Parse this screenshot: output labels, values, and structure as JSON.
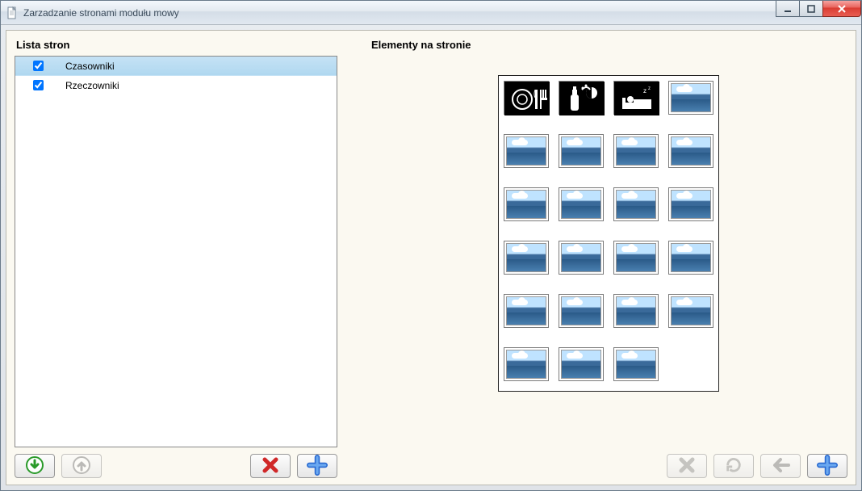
{
  "window": {
    "title": "Zarzadzanie stronami modułu mowy"
  },
  "left": {
    "header": "Lista stron",
    "items": [
      {
        "label": "Czasowniki",
        "checked": true,
        "selected": true
      },
      {
        "label": "Rzeczowniki",
        "checked": true,
        "selected": false
      }
    ]
  },
  "right": {
    "header": "Elementy na stronie",
    "tiles": [
      {
        "kind": "icon",
        "name": "eat-icon"
      },
      {
        "kind": "icon",
        "name": "drink-icon"
      },
      {
        "kind": "icon",
        "name": "sleep-icon"
      },
      {
        "kind": "placeholder"
      },
      {
        "kind": "placeholder"
      },
      {
        "kind": "placeholder"
      },
      {
        "kind": "placeholder"
      },
      {
        "kind": "placeholder"
      },
      {
        "kind": "placeholder"
      },
      {
        "kind": "placeholder"
      },
      {
        "kind": "placeholder"
      },
      {
        "kind": "placeholder"
      },
      {
        "kind": "placeholder"
      },
      {
        "kind": "placeholder"
      },
      {
        "kind": "placeholder"
      },
      {
        "kind": "placeholder"
      },
      {
        "kind": "placeholder"
      },
      {
        "kind": "placeholder"
      },
      {
        "kind": "placeholder"
      },
      {
        "kind": "placeholder"
      },
      {
        "kind": "placeholder"
      },
      {
        "kind": "placeholder"
      },
      {
        "kind": "placeholder"
      }
    ]
  },
  "buttons": {
    "left": [
      {
        "name": "move-down-button",
        "icon": "arrow-down-circle-icon",
        "enabled": true
      },
      {
        "name": "move-up-button",
        "icon": "arrow-up-circle-icon",
        "enabled": false
      },
      {
        "name": "delete-page-button",
        "icon": "delete-x-icon",
        "enabled": true,
        "push": "right"
      },
      {
        "name": "add-page-button",
        "icon": "plus-icon",
        "enabled": true
      }
    ],
    "right": [
      {
        "name": "delete-element-button",
        "icon": "delete-x-icon",
        "enabled": false
      },
      {
        "name": "refresh-button",
        "icon": "refresh-icon",
        "enabled": false
      },
      {
        "name": "back-button",
        "icon": "arrow-left-icon",
        "enabled": false
      },
      {
        "name": "add-element-button",
        "icon": "plus-icon",
        "enabled": true
      }
    ]
  }
}
